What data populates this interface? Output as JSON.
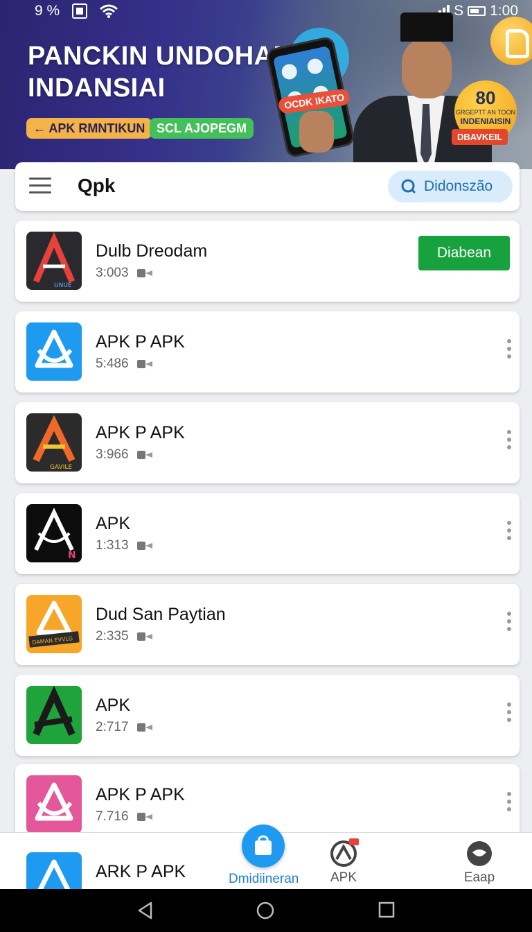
{
  "status_bar": {
    "battery_left": "9 %",
    "time": "1:00",
    "sim_label": "S"
  },
  "banner": {
    "title_line1": "PANCKIN UNDOHAN",
    "title_line2": "INDANSIAI",
    "pill_left": "← APK RMNTIKUN",
    "pill_right": "SCL AJOPEGM",
    "phone_tag": "OCDK IKATO",
    "badge_num": "80",
    "badge_small": "GRGEPTT AN TOON",
    "badge_text": "INDENIAISIN",
    "badge_red": "DBAVKEIL"
  },
  "topbar": {
    "title": "Qpk",
    "search_label": "Didonszão"
  },
  "apps": [
    {
      "name": "Dulb Dreodam",
      "meta": "3:003",
      "action": "Diabean"
    },
    {
      "name": "APK P APK",
      "meta": "5:486"
    },
    {
      "name": "APK P APK",
      "meta": "3:966"
    },
    {
      "name": "APK",
      "meta": "1:313"
    },
    {
      "name": "Dud San Paytian",
      "meta": "2:335"
    },
    {
      "name": "APK",
      "meta": "2:717"
    },
    {
      "name": "APK P APK",
      "meta": "7.716"
    }
  ],
  "peek_app": {
    "name": "ARK P APK"
  },
  "icon_labels": {
    "app0_tag": "UNUE",
    "app2_tag": "GAVILE",
    "app3_tag": "N",
    "app4_tag": "DAMAN EVVLG"
  },
  "bottom_nav": {
    "active_label": "Dmidiineran",
    "apk_label": "APK",
    "eaap_label": "Eaap"
  },
  "colors": {
    "accent_blue": "#1e9bf0",
    "download_green": "#18a23e",
    "banner_purple": "#2b2470"
  }
}
